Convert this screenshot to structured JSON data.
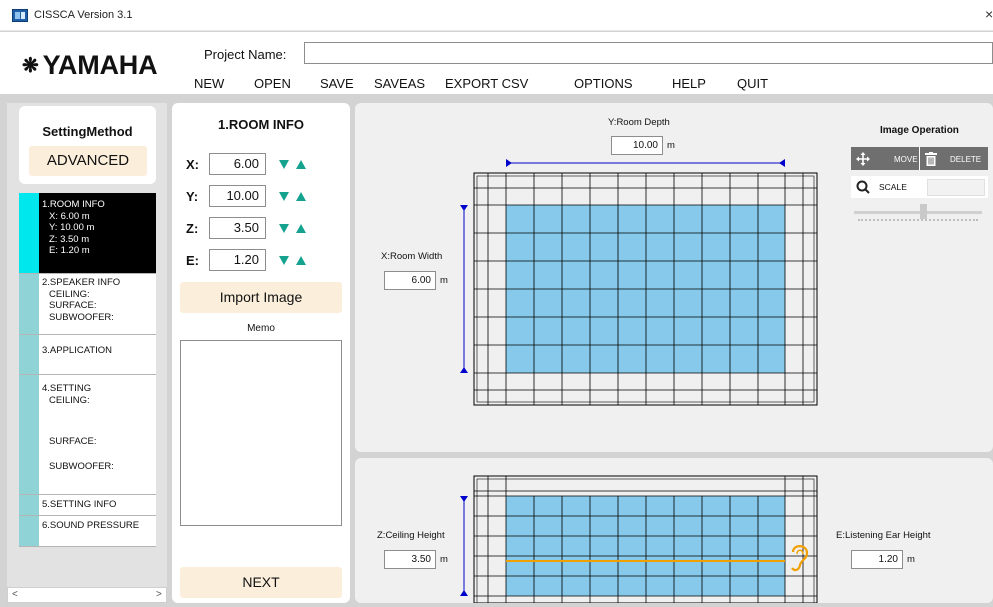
{
  "window": {
    "title": "CISSCA Version 3.1",
    "close": "×"
  },
  "header": {
    "logo": "YAMAHA",
    "project_label": "Project Name:",
    "project_value": "",
    "menu": [
      "NEW",
      "OPEN",
      "SAVE",
      "SAVEAS",
      "EXPORT CSV",
      "OPTIONS",
      "HELP",
      "QUIT"
    ]
  },
  "sidebar": {
    "setting_method_title": "SettingMethod",
    "mode": "ADVANCED",
    "items": [
      {
        "label": "1.ROOM INFO",
        "sub": [
          "X: 6.00 m",
          "Y: 10.00 m",
          "Z: 3.50 m",
          "E: 1.20 m"
        ]
      },
      {
        "label": "2.SPEAKER INFO",
        "sub": [
          "CEILING:",
          "SURFACE:",
          "SUBWOOFER:"
        ]
      },
      {
        "label": "3.APPLICATION",
        "sub": []
      },
      {
        "label": "4.SETTING",
        "sub": [
          "CEILING:",
          "",
          "",
          "SURFACE:",
          "",
          "SUBWOOFER:"
        ]
      },
      {
        "label": "5.SETTING INFO",
        "sub": []
      },
      {
        "label": "6.SOUND PRESSURE",
        "sub": []
      }
    ],
    "scroll_left": "<",
    "scroll_right": ">"
  },
  "room_info": {
    "title": "1.ROOM INFO",
    "fields": [
      {
        "label": "X:",
        "value": "6.00"
      },
      {
        "label": "Y:",
        "value": "10.00"
      },
      {
        "label": "Z:",
        "value": "3.50"
      },
      {
        "label": "E:",
        "value": "1.20"
      }
    ],
    "import_button": "Import Image",
    "memo_label": "Memo",
    "memo_value": "",
    "next_button": "NEXT"
  },
  "plan_view": {
    "depth_label": "Y:Room Depth",
    "depth_value": "10.00",
    "width_label": "X:Room Width",
    "width_value": "6.00",
    "unit": "m"
  },
  "image_operation": {
    "title": "Image Operation",
    "move": "MOVE",
    "delete": "DELETE",
    "scale": "SCALE"
  },
  "section_view": {
    "ceiling_label": "Z:Ceiling Height",
    "ceiling_value": "3.50",
    "ear_label": "E:Listening Ear Height",
    "ear_value": "1.20",
    "unit": "m"
  },
  "colors": {
    "room_fill": "#86c9ea",
    "accent": "#14a38f",
    "dimension_line": "#0000cc",
    "ear_line": "#f0a000",
    "active_nav": "#000000",
    "nav_bar": "#8fd3d6"
  }
}
